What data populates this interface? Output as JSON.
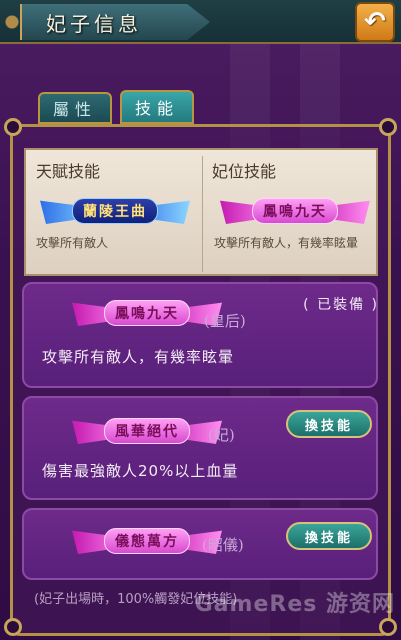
{
  "header": {
    "title": "妃子信息",
    "back_icon": "return-arrow-icon"
  },
  "tabs": [
    {
      "label": "屬性",
      "active": false
    },
    {
      "label": "技能",
      "active": true
    }
  ],
  "info": {
    "talent": {
      "label": "天賦技能",
      "skill_name": "蘭陵王曲",
      "description": "攻擊所有敵人"
    },
    "rank": {
      "label": "妃位技能",
      "skill_name": "鳳鳴九天",
      "description": "攻擊所有敵人，有幾率眩暈"
    }
  },
  "skills": [
    {
      "name": "鳳鳴九天",
      "position": "(皇后)",
      "description": "攻擊所有敵人，有幾率眩暈",
      "status": "( 已裝備 )"
    },
    {
      "name": "風華絕代",
      "position": "(妃)",
      "description": "傷害最強敵人20%以上血量",
      "button": "換技能"
    },
    {
      "name": "儀態萬方",
      "position": "(昭儀)",
      "button": "換技能"
    }
  ],
  "footer": {
    "note": "(妃子出場時，100%觸發妃位技能)"
  },
  "watermark": "GameRes 游资网",
  "colors": {
    "accent_gold": "#b39245",
    "panel_purple": "#58207a",
    "button_teal": "#1d6f6a"
  }
}
